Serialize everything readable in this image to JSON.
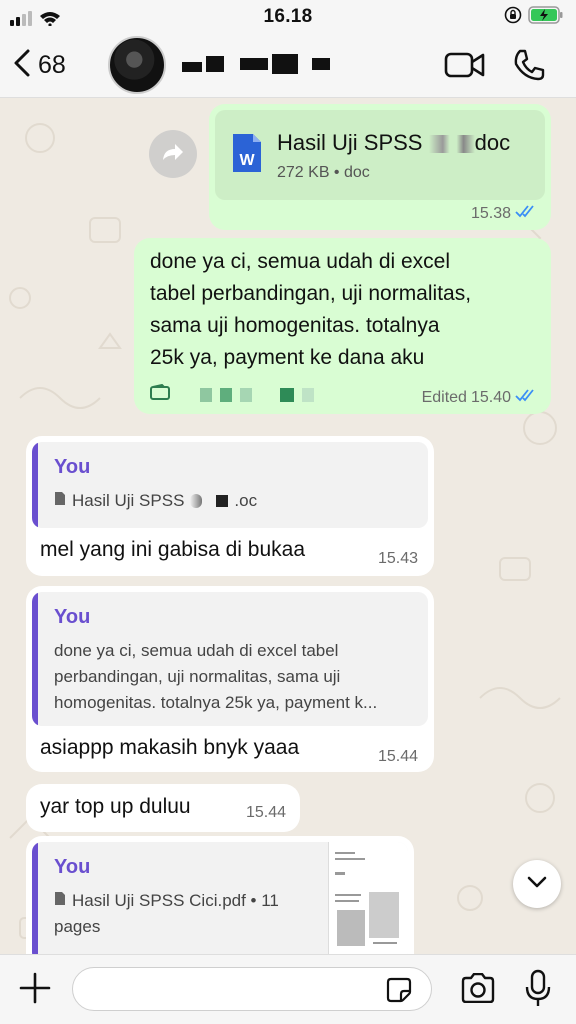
{
  "status_bar": {
    "time": "16.18"
  },
  "header": {
    "back_count": "68"
  },
  "messages": {
    "doc_out": {
      "file_name_start": "Hasil Uji SPSS",
      "file_name_end": "doc",
      "file_meta": "272 KB • doc",
      "file_icon_letter": "W",
      "time": "15.38"
    },
    "text_out": {
      "line1": "done ya ci, semua udah di excel",
      "line2": "tabel perbandingan, uji normalitas,",
      "line3": "sama uji homogenitas. totalnya",
      "line4": "25k ya, payment ke dana aku",
      "edited": "Edited",
      "time": "15.40"
    },
    "reply1": {
      "quote_author": "You",
      "quote_file_start": "Hasil Uji SPSS",
      "quote_file_end": ".oc",
      "text": "mel yang ini gabisa di bukaa",
      "time": "15.43"
    },
    "reply2": {
      "quote_author": "You",
      "quote_line1": "done ya ci, semua udah di excel tabel",
      "quote_line2": "perbandingan, uji normalitas, sama uji",
      "quote_line3": "homogenitas. totalnya 25k ya, payment k...",
      "text": "asiappp makasih bnyk yaaa",
      "time": "15.44"
    },
    "plain": {
      "text": "yar top up duluu",
      "time": "15.44"
    },
    "reply3": {
      "quote_author": "You",
      "quote_line1": "Hasil Uji SPSS Cici.pdf • 11",
      "quote_line2": "pages"
    }
  },
  "input": {
    "placeholder": ""
  },
  "colors": {
    "outgoing": "#d9fdd3",
    "incoming": "#ffffff",
    "quote_accent": "#6a4fcf",
    "read_ticks": "#3a8ef6"
  }
}
